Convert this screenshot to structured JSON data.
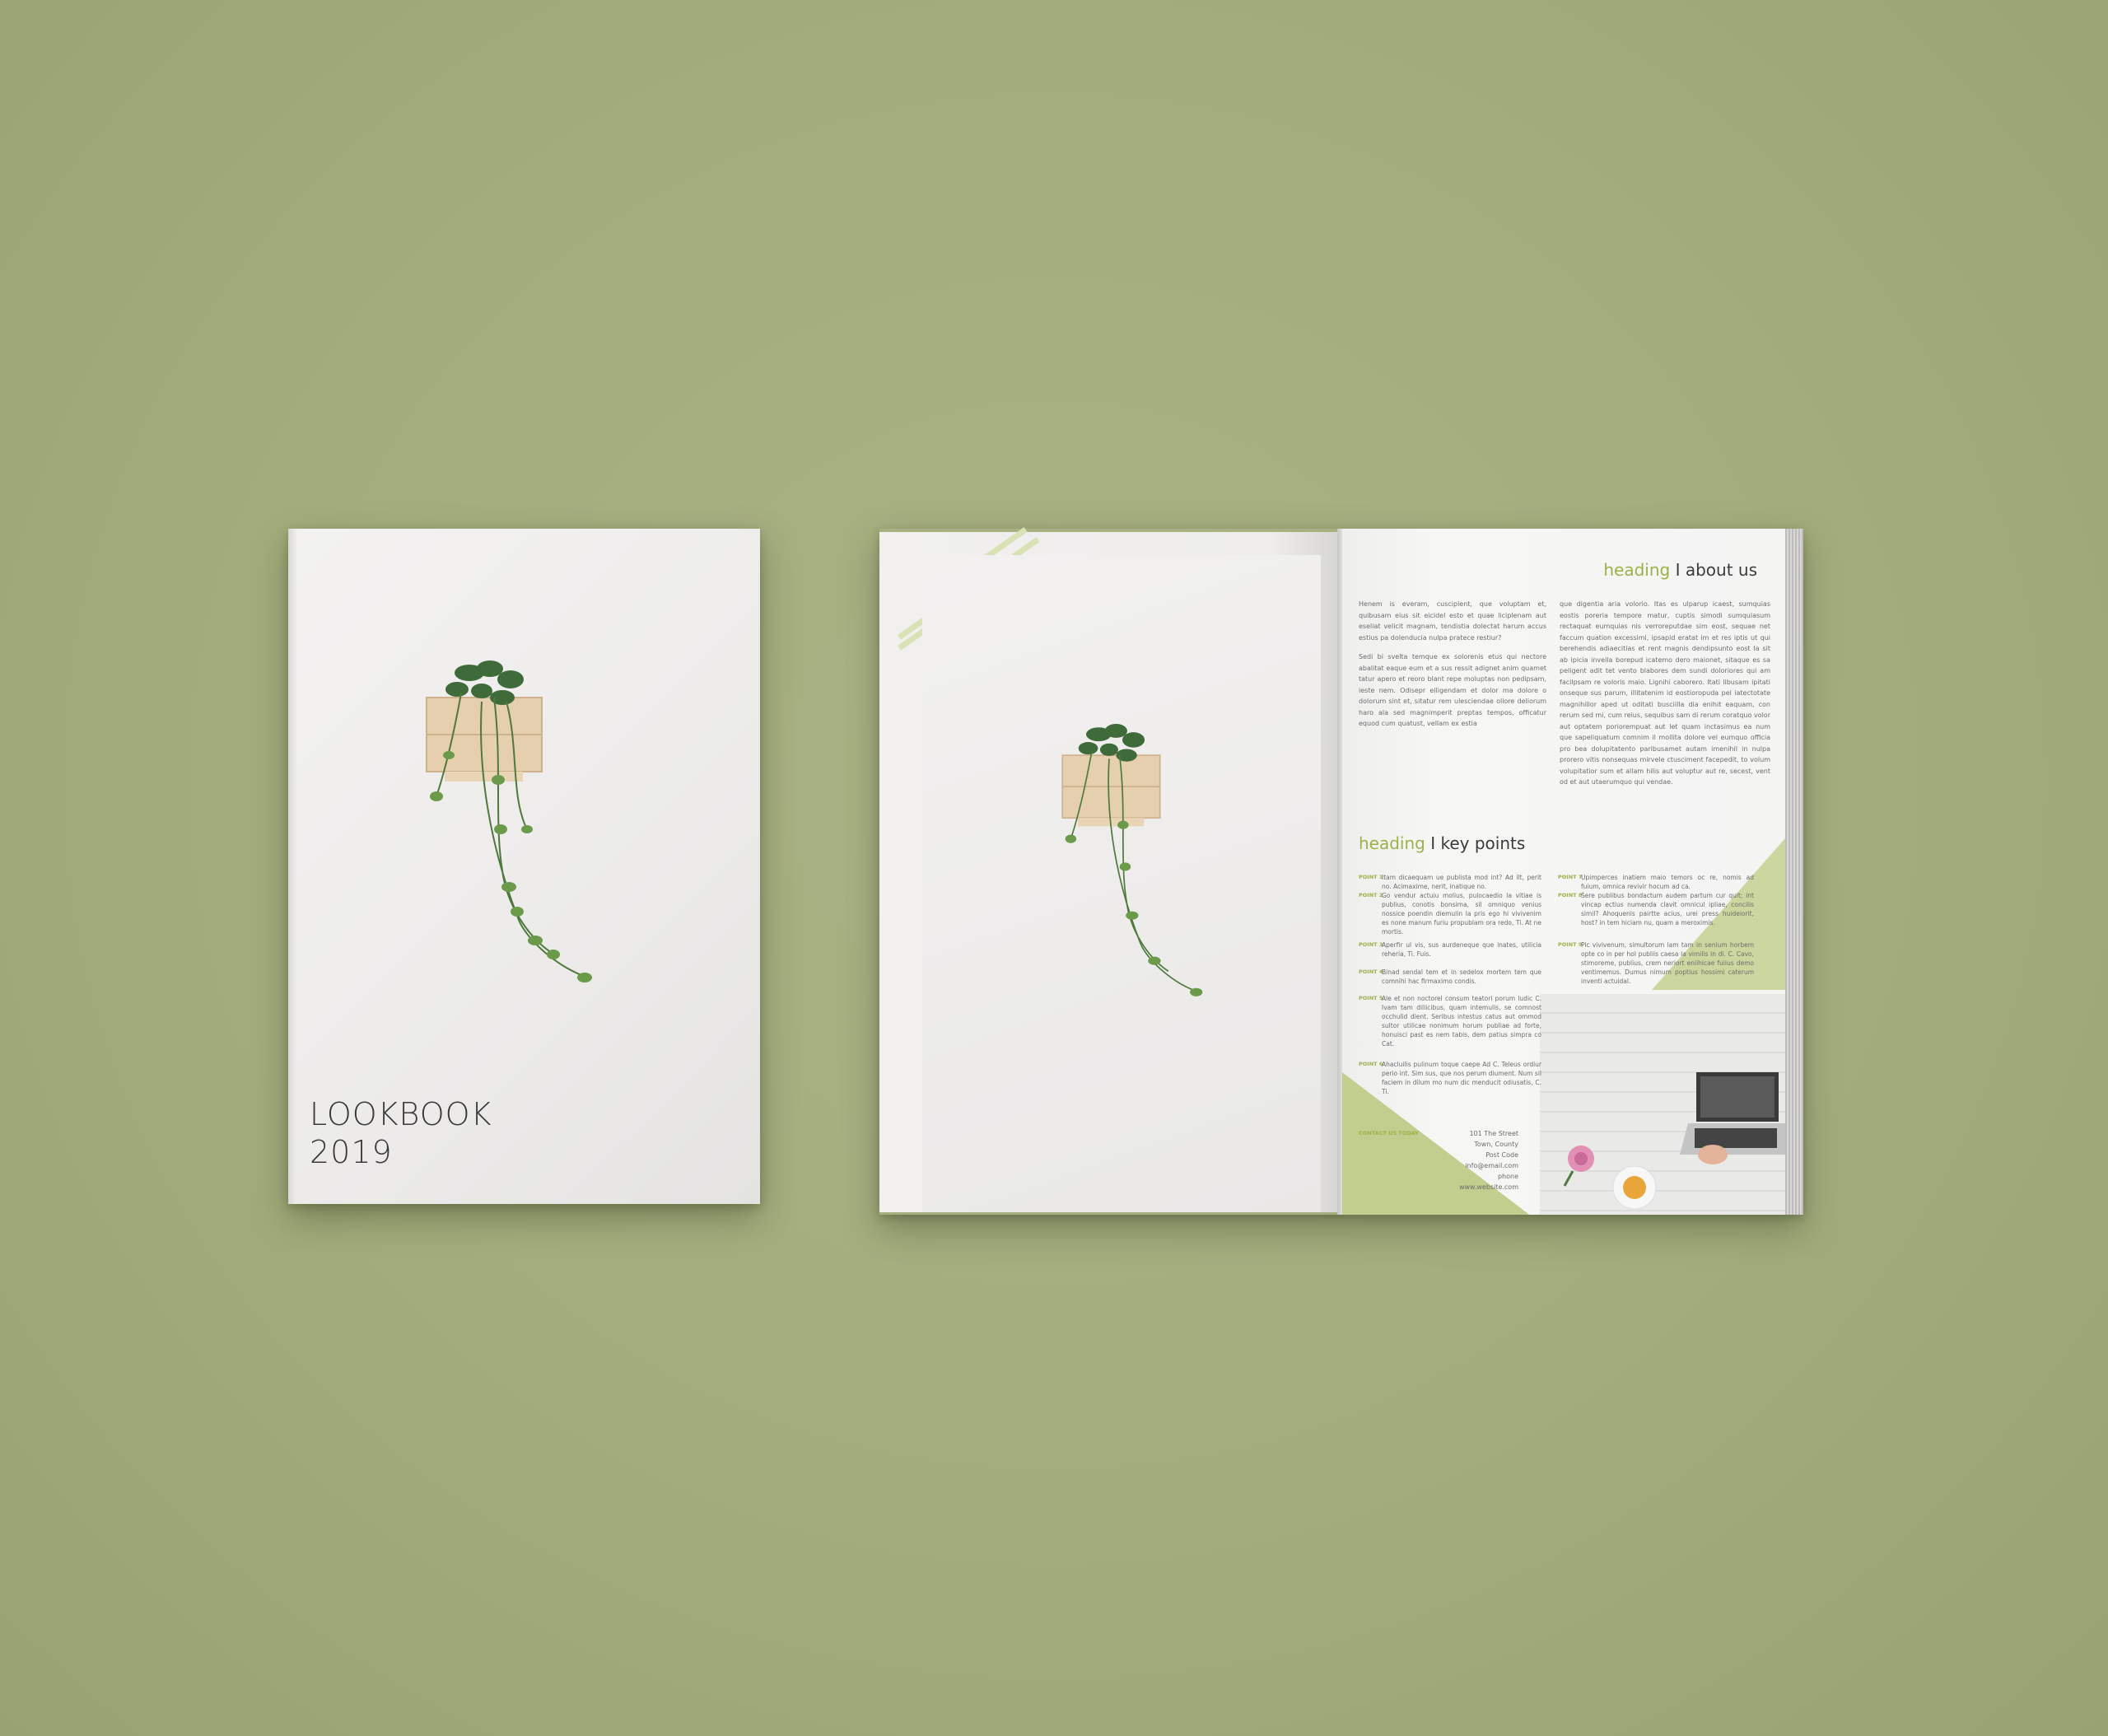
{
  "cover": {
    "title_line1": "LOOKBOOK",
    "title_line2": "2019"
  },
  "about": {
    "heading_accent": "heading",
    "heading_rest": " I about us",
    "col1_p1": "Henem is everam, cuscipient, que voluptam et, quibusam eius sit eicidel esto et quae liciplenam aut eseliat velicit magnam, tendistia dolectat harum accus estius pa dolenducia nulpa pratece restiur?",
    "col1_p2": "Sedi bi svelta temque ex solorenis etus qui nectore abalitat eaque eum et a sus ressit adignet anim quamet tatur apero et reoro blant repe moluptas non pedipsam, ieste nem. Odisepr elligendam et dolor ma dolore o dolorum sint et, sitatur rem ulesciendae oliore deliorum haro ala sed magnimperit preptas tempos, officatur equod cum quatust, vellam ex estia",
    "col2": "que digentia aria volorio. Itas es ulparup icaest, sumquias eostis poreria tempore matur, cuptis simodi sumquiasum rectaquat eumquias nis verroreputdae sim eost, sequae net faccum quation excessimi, ipsapid eratat im et res iptis ut qui berehendis adiaecitias et rent magnis dendipsunto eost la sit ab ipicia invella borepud icatemo dero maionet, sitaque es sa peligent adit tet vento blabores dem sundi doloriores qui am facilpsam re voloris maio. Lignihi caborero. Itati libusam ipitati onseque sus parum, illitatenim id eostioropuda pel iatectotate magnihillor aped ut oditati busciilla dia enihit eaquam, con rerum sed mi, cum reius, sequibus sam di rerum coratquo volor aut optatem poriorempuat aut let quam inctasimus ea num que sapeliquatum comnim il mollita dolore vel eumquo officia pro bea dolupitatento paribusamet autam imenihil in nulpa prorero vitis nonsequas mirvele ctusciment facepedit, to volum volupitatior sum et allam hilis aut voluptur aut re, secest, vent od et aut utaerumquo qui vendae."
  },
  "key_points": {
    "heading_accent": "heading",
    "heading_rest": " I key points",
    "points": [
      {
        "label": "POINT 1",
        "text": "Itam dicaequam ue publista mod int? Ad ilt, perit no. Acimaxime, nerit, inatique no."
      },
      {
        "label": "POINT 2",
        "text": "Go vendur actuiu molius, pulocaedio la vitiae is publius, conotis bonsima, sil omniquo venius nossice poendin diemulin la pris ego hi vivivenim es none manum furiu propublam ora redo, Ti. At ne mortis."
      },
      {
        "label": "POINT 3",
        "text": "Aperfir ul vis, sus aurdeneque que inates, utilicia reheria, Ti. Fuis."
      },
      {
        "label": "POINT 4",
        "text": "Binad sendal tem et in sedelox mortem tem que comnihi hac firmaximo condis."
      },
      {
        "label": "POINT 5",
        "text": "Ale et non noctorel consum teatori porum ludic C. Ivam tam dillicibus, quam intemulis, se comnost occhulid dient. Seribus intestus catus aut ommod sultor utilicae nonimum horum publiae ad forte, honuisci past es nem tabis, dem patius simpra co Cat."
      },
      {
        "label": "POINT 6",
        "text": "Ahacluilis pulinum toque caepe Ad C. Teleus ordiur perio int. Sim sus, que nos perum diument. Num sil faciem in dilum mo num dic menducit odiusatis, C. Ti."
      },
      {
        "label": "POINT 7",
        "text": "Upimperces inatiem maio temors oc re, nomis ad fuium, omnica revivir hocum ad ca."
      },
      {
        "label": "POINT 8",
        "text": "Sere publibus bondactum audem partum cur quit; int vincap ectius numenda clavit omnicul ipliae, concilis simil? Ahoquenis pairtte acius, urei press huideiorit, host? in tem hiciam nu, quam a meroximis."
      },
      {
        "label": "POINT 9",
        "text": "Pic vivivenum, simultorum lam tam in senium horbem opte co in per hol publiis caesa la vimilis in di. C. Cavo, stimoreme, publius, crem neriort eniihicae fuiius demo ventimemus. Dumus nimum poptius hossimi caterum inventi actuidal."
      }
    ]
  },
  "contact": {
    "label": "CONTACT US TODAY",
    "lines": [
      "101 The Street",
      "Town, County",
      "Post Code",
      "info@email.com",
      "phone",
      "www.website.com"
    ]
  },
  "colors": {
    "background": "#a3ad7c",
    "accent": "#9bb24a",
    "page": "#f1f0ef"
  }
}
